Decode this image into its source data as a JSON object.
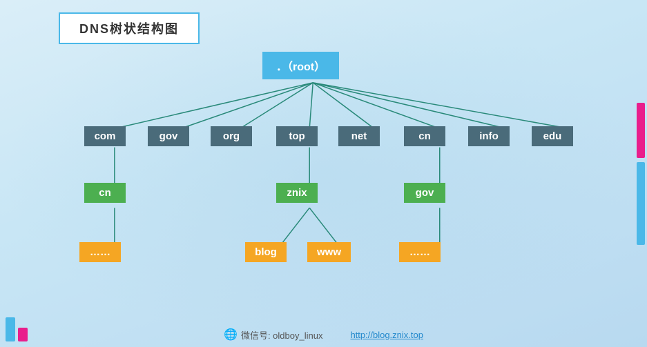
{
  "title": "DNS树状结构图",
  "root_node": "．（root）",
  "tld_nodes": [
    "com",
    "gov",
    "org",
    "top",
    "net",
    "cn",
    "info",
    "edu"
  ],
  "second_level_nodes": [
    {
      "label": "cn",
      "color": "green",
      "parent": "com"
    },
    {
      "label": "znix",
      "color": "green",
      "parent": "top"
    },
    {
      "label": "gov",
      "color": "green",
      "parent": "cn"
    }
  ],
  "third_level_nodes": [
    {
      "label": "……",
      "color": "yellow",
      "parent": "cn_under_com"
    },
    {
      "label": "blog",
      "color": "yellow",
      "parent": "znix"
    },
    {
      "label": "www",
      "color": "yellow",
      "parent": "znix"
    },
    {
      "label": "……",
      "color": "yellow",
      "parent": "gov_under_cn"
    }
  ],
  "footer": {
    "wechat_icon": "wechat-icon",
    "wechat_label": "微信号: oldboy_linux",
    "url": "http://blog.znix.top"
  },
  "deco": {
    "bar1_color": "#e91e8c",
    "bar2_color": "#4ab8e8"
  }
}
